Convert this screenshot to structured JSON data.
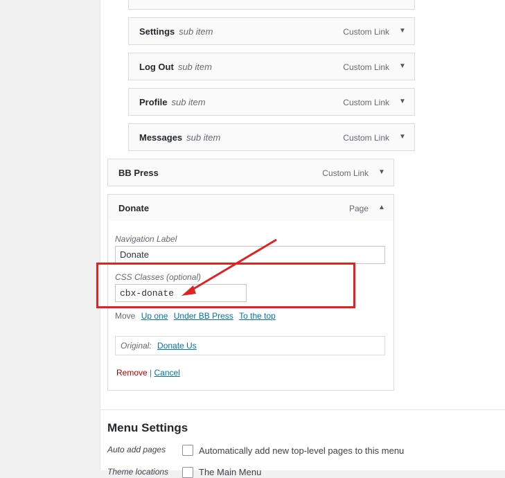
{
  "sub_items": [
    {
      "title": "Settings",
      "sub": "sub item",
      "type": "Custom Link"
    },
    {
      "title": "Log Out",
      "sub": "sub item",
      "type": "Custom Link"
    },
    {
      "title": "Profile",
      "sub": "sub item",
      "type": "Custom Link"
    },
    {
      "title": "Messages",
      "sub": "sub item",
      "type": "Custom Link"
    }
  ],
  "bbpress": {
    "title": "BB Press",
    "type": "Custom Link"
  },
  "donate": {
    "title": "Donate",
    "type": "Page",
    "nav_label": "Navigation Label",
    "nav_value": "Donate",
    "css_label": "CSS Classes (optional)",
    "css_value": "cbx-donate",
    "move_label": "Move",
    "move_links": [
      "Up one",
      "Under BB Press",
      "To the top"
    ],
    "original_label": "Original:",
    "original_link": "Donate Us",
    "remove": "Remove",
    "separator": "|",
    "cancel": "Cancel"
  },
  "menu_settings": {
    "title": "Menu Settings",
    "auto_add_label": "Auto add pages",
    "auto_add_text": "Automatically add new top-level pages to this menu",
    "auto_add_checked": false,
    "next_label": "Theme locations",
    "next_text": "The Main Menu"
  },
  "annotation": {
    "color": "#e02222"
  }
}
